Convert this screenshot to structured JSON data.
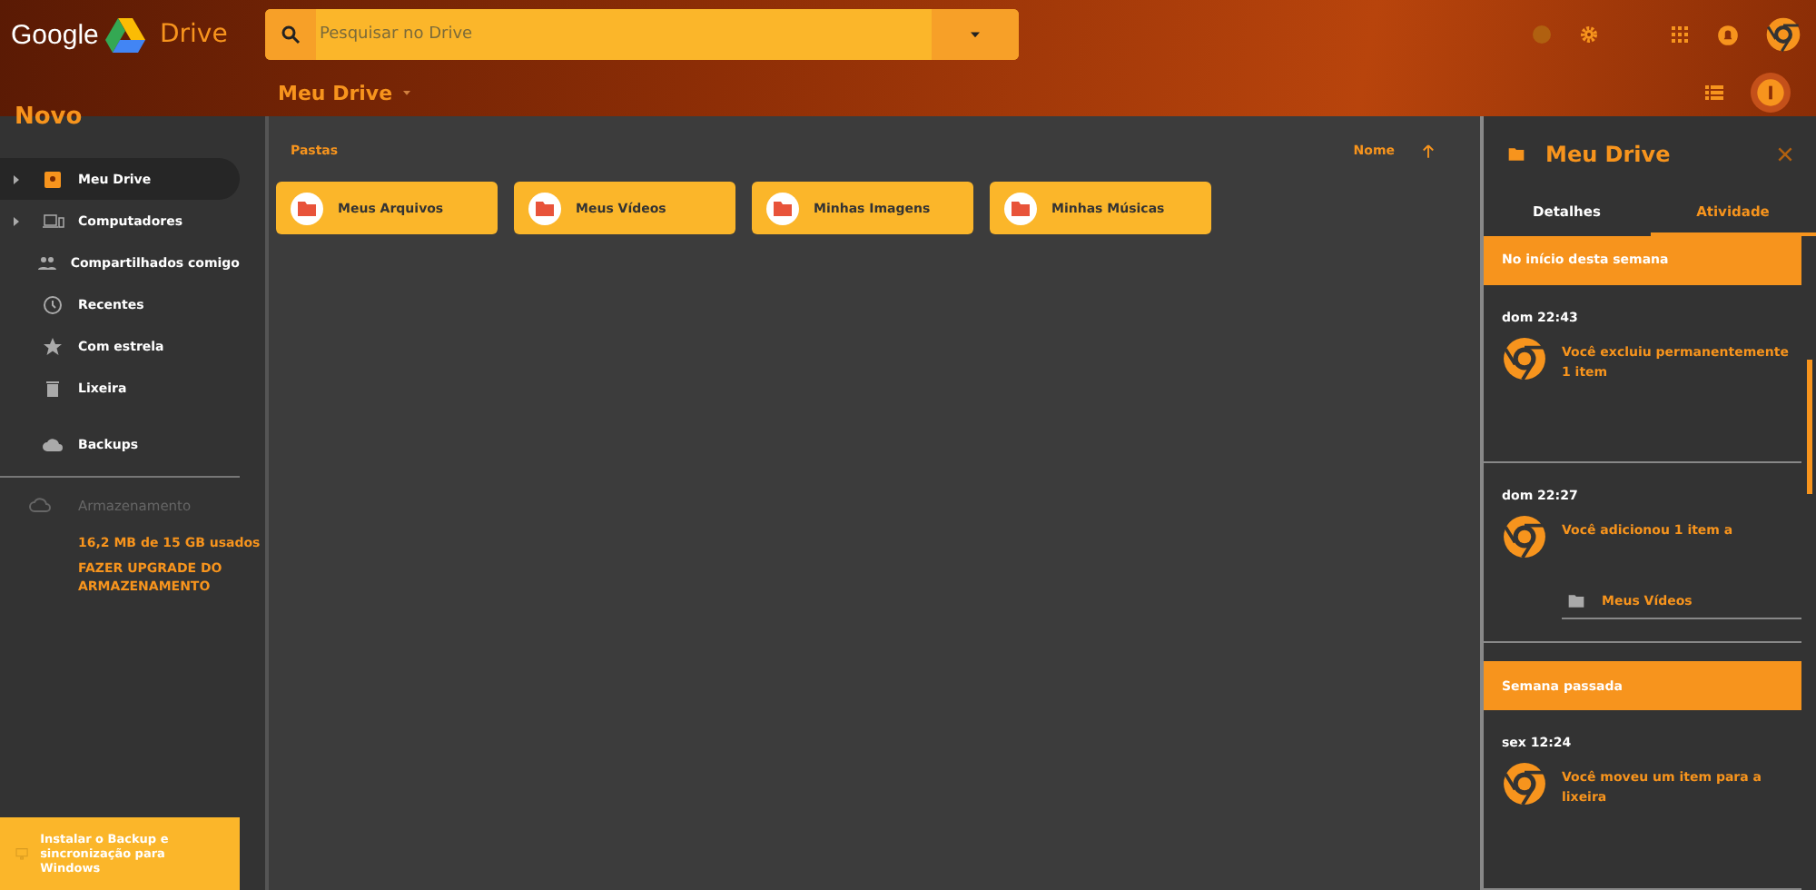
{
  "header": {
    "brand": "Google",
    "product": "Drive",
    "search": {
      "placeholder": "Pesquisar no Drive"
    }
  },
  "toolbar": {
    "breadcrumb": "Meu Drive"
  },
  "sidebar": {
    "new_button": "Novo",
    "items": [
      {
        "label": "Meu Drive",
        "kind": "drive",
        "selected": true,
        "expandable": true
      },
      {
        "label": "Computadores",
        "kind": "computers",
        "selected": false,
        "expandable": true
      },
      {
        "label": "Compartilhados comigo",
        "kind": "shared",
        "selected": false,
        "expandable": false
      },
      {
        "label": "Recentes",
        "kind": "recent",
        "selected": false,
        "expandable": false
      },
      {
        "label": "Com estrela",
        "kind": "starred",
        "selected": false,
        "expandable": false
      },
      {
        "label": "Lixeira",
        "kind": "trash",
        "selected": false,
        "expandable": false
      },
      {
        "label": "Backups",
        "kind": "backups",
        "selected": false,
        "expandable": false
      }
    ],
    "storage": {
      "label": "Armazenamento",
      "usage": "16,2 MB de 15 GB usados",
      "upgrade": "FAZER UPGRADE DO ARMAZENAMENTO"
    },
    "install_banner": "Instalar o Backup e sincronização para Windows"
  },
  "content": {
    "section": "Pastas",
    "sort": "Nome",
    "folders": [
      "Meus Arquivos",
      "Meus Vídeos",
      "Minhas Imagens",
      "Minhas Músicas"
    ]
  },
  "details_panel": {
    "title": "Meu Drive",
    "tabs": [
      {
        "label": "Detalhes",
        "selected": false
      },
      {
        "label": "Atividade",
        "selected": true
      }
    ],
    "groups": [
      {
        "heading": "No início desta semana",
        "entries": [
          {
            "time": "dom 22:43",
            "text": "Você excluiu permanentemente 1 item"
          },
          {
            "time": "dom 22:27",
            "text": "Você adicionou 1 item a",
            "target": "Meus Vídeos"
          }
        ]
      },
      {
        "heading": "Semana passada",
        "entries": [
          {
            "time": "sex 12:24",
            "text": "Você moveu um item para a lixeira"
          }
        ]
      }
    ]
  }
}
